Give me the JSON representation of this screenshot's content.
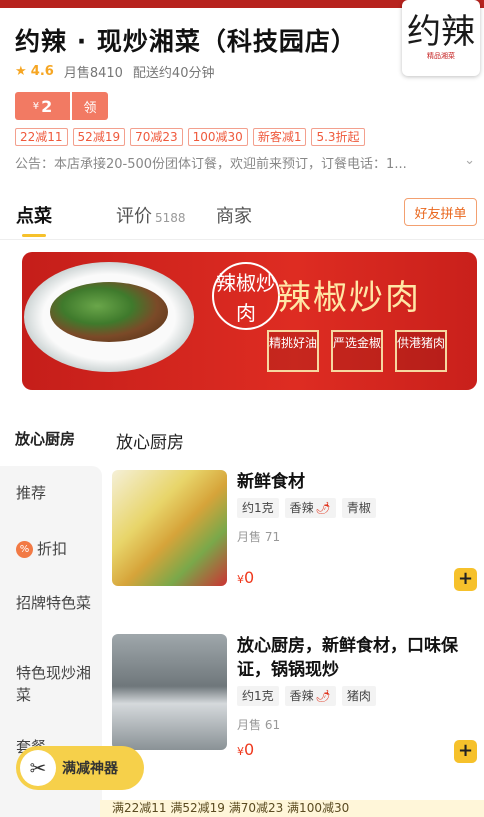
{
  "store": {
    "name": "约辣 · 现炒湘菜（科技园店）",
    "logo_text": "约辣",
    "logo_sub": "精品湘菜",
    "rating": "4.6",
    "monthly_sales": "月售8410",
    "delivery_time": "配送约40分钟"
  },
  "coupon": {
    "currency": "¥",
    "amount": "2",
    "claim_label": "领"
  },
  "promotions": [
    "22减11",
    "52减19",
    "70减23",
    "100减30",
    "新客减1",
    "5.3折起"
  ],
  "notice": "公告：本店承接20-500份团体订餐，欢迎前来预订，订餐电话：1...",
  "tabs": [
    {
      "label": "点菜"
    },
    {
      "label": "评价",
      "count": "5188"
    },
    {
      "label": "商家"
    }
  ],
  "friend_button": "好友拼单",
  "banner": {
    "circle_text": "辣椒炒肉",
    "title": "辣椒炒肉",
    "tags": [
      "精挑好油",
      "严选金椒",
      "供港猪肉"
    ]
  },
  "section": {
    "sidebar_title": "放心厨房",
    "content_title": "放心厨房"
  },
  "sidebar": [
    {
      "label": "推荐"
    },
    {
      "label": "折扣",
      "icon": "discount-icon"
    },
    {
      "label": "招牌特色菜"
    },
    {
      "label": "特色现炒湘菜"
    },
    {
      "label": "套餐"
    }
  ],
  "dishes": [
    {
      "name": "新鲜食材",
      "chips": [
        {
          "text": "约1克"
        },
        {
          "text": "香辣",
          "pepper": "🌶"
        },
        {
          "text": "青椒"
        }
      ],
      "sales": "月售 71",
      "currency": "¥",
      "price": "0"
    },
    {
      "name": "放心厨房，新鲜食材，口味保证，锅锅现炒",
      "chips": [
        {
          "text": "约1克"
        },
        {
          "text": "香辣",
          "pepper": "🌶"
        },
        {
          "text": "猪肉"
        }
      ],
      "sales": "月售 61",
      "currency": "¥",
      "price": "0"
    }
  ],
  "float_badge": {
    "icon": "ticket-icon",
    "label": "满减神器"
  },
  "promo_bar": "满22减11 满52减19 满70减23 满100减30",
  "colors": {
    "accent": "#f6c12b",
    "price": "#ef3a1f",
    "coupon": "#f27a63",
    "brand": "#b7231e"
  }
}
